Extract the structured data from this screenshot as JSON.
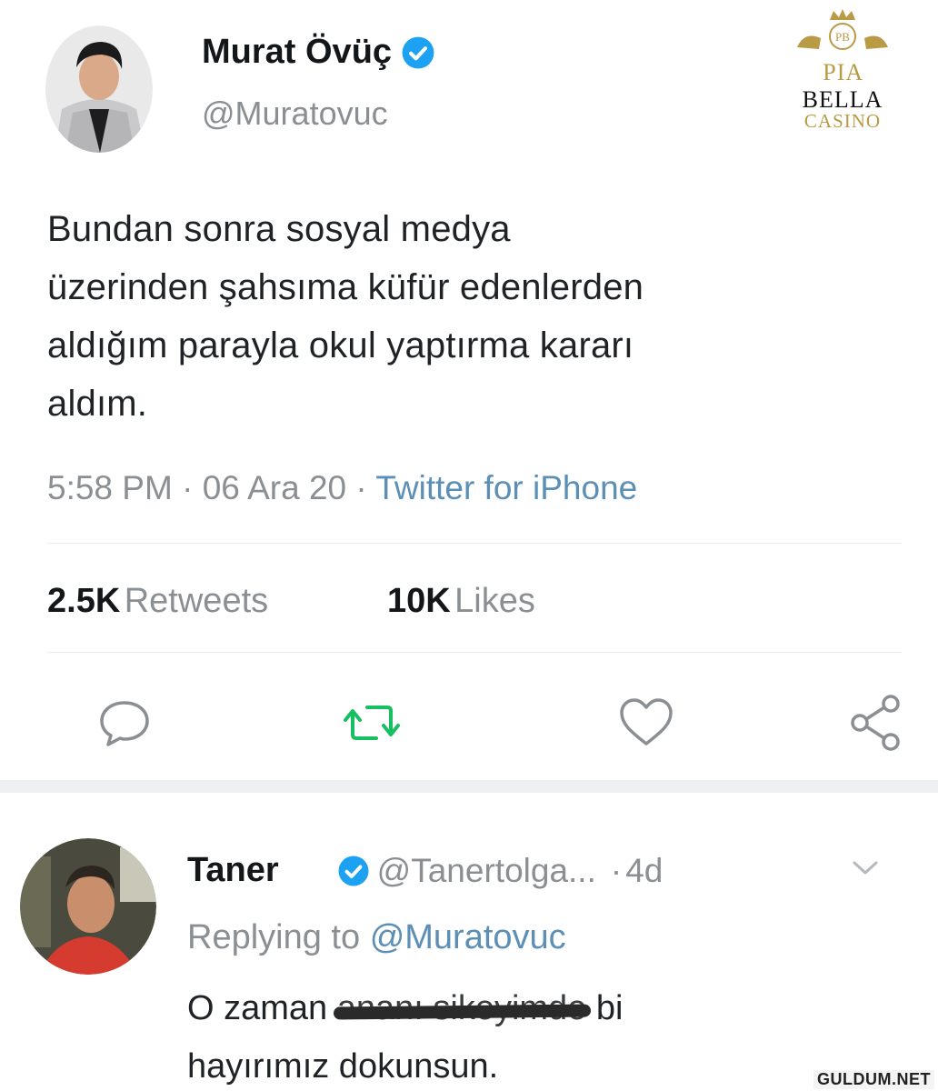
{
  "tweet": {
    "author_name": "Murat Övüç",
    "author_handle": "@Muratovuc",
    "text_lines": [
      "Bundan sonra sosyal medya",
      "üzerinden şahsıma küfür edenlerden",
      "aldığım parayla okul yaptırma kararı",
      "aldım."
    ],
    "time": "5:58 PM",
    "date": "06 Ara 20",
    "source": "Twitter for iPhone",
    "retweets_count": "2.5K",
    "retweets_label": "Retweets",
    "likes_count": "10K",
    "likes_label": "Likes"
  },
  "actions": {
    "reply_icon": "reply-icon",
    "retweet_icon": "retweet-icon",
    "like_icon": "heart-icon",
    "share_icon": "share-icon",
    "retweet_color": "#17bf63"
  },
  "reply": {
    "author_name": "Taner",
    "author_handle": "@Tanertolga...",
    "age": "4d",
    "replying_prefix": "Replying to",
    "replying_handle": "@Muratovuc",
    "text_before": "O zaman ",
    "text_redacted": "ananı sikeyimde",
    "text_after": " bi",
    "text_line2": "hayırımız dokunsun."
  },
  "watermarks": {
    "brand_line1a": "PIA",
    "brand_line1b": "BELLA",
    "brand_line2": "CASINO",
    "crest_text": "PB",
    "site": "GULDUM.NET"
  },
  "colors": {
    "verified": "#1da1f2",
    "link": "#5b8fb5",
    "muted": "#8a8f94"
  }
}
